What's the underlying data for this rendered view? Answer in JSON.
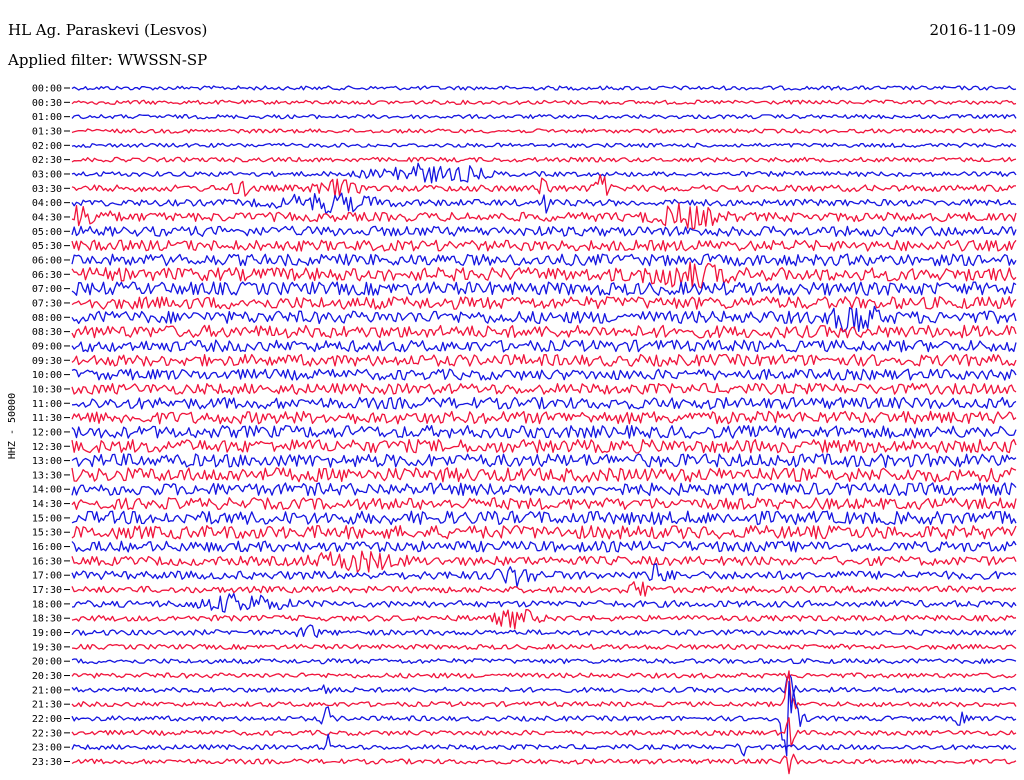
{
  "header": {
    "station": "HL Ag. Paraskevi (Lesvos)",
    "date": "2016-11-09",
    "filter": "Applied filter: WWSSN-SP"
  },
  "chart_data": {
    "type": "line",
    "description_kind": "helicorder",
    "ylabel": "HHZ - 50000",
    "time_labels": [
      "00:00",
      "00:30",
      "01:00",
      "01:30",
      "02:00",
      "02:30",
      "03:00",
      "03:30",
      "04:00",
      "04:30",
      "05:00",
      "05:30",
      "06:00",
      "06:30",
      "07:00",
      "07:30",
      "08:00",
      "08:30",
      "09:00",
      "09:30",
      "10:00",
      "10:30",
      "11:00",
      "11:30",
      "12:00",
      "12:30",
      "13:00",
      "13:30",
      "14:00",
      "14:30",
      "15:00",
      "15:30",
      "16:00",
      "16:30",
      "17:00",
      "17:30",
      "18:00",
      "18:30",
      "19:00",
      "19:30",
      "20:00",
      "20:30",
      "21:00",
      "21:30",
      "22:00",
      "22:30",
      "23:00",
      "23:30"
    ],
    "trace_colors": [
      "#1515e0",
      "#f0143c"
    ],
    "noise_level": [
      0.2,
      0.2,
      0.2,
      0.2,
      0.2,
      0.25,
      0.3,
      0.5,
      0.5,
      0.8,
      0.9,
      1.0,
      1.1,
      1.3,
      1.3,
      1.2,
      1.2,
      1.2,
      1.1,
      1.1,
      1.0,
      1.0,
      1.1,
      1.2,
      1.2,
      1.3,
      1.3,
      1.4,
      1.2,
      1.1,
      1.3,
      1.3,
      1.0,
      0.8,
      0.7,
      0.5,
      0.5,
      0.4,
      0.35,
      0.3,
      0.3,
      0.3,
      0.3,
      0.3,
      0.3,
      0.3,
      0.3,
      0.3
    ]
  }
}
